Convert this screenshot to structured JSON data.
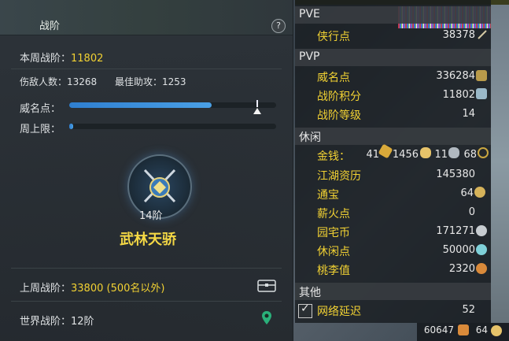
{
  "left": {
    "title": "战阶",
    "help": "?",
    "week_label": "本周战阶：",
    "week_value": "11802",
    "kills_label": "伤敌人数：13268",
    "assist_label": "最佳助攻：1253",
    "fame_label": "威名点：",
    "fame_progress": 0.69,
    "cap_label": "周上限：",
    "cap_progress": 0.02,
    "rank_level": "14阶",
    "rank_name": "武林天骄",
    "last_week_label": "上周战阶：",
    "last_week_value": "33800 (500名以外)",
    "world_label": "世界战阶：12阶"
  },
  "right": {
    "pve": {
      "header": "PVE",
      "rows": [
        {
          "label": "侠行点",
          "value": "38378"
        }
      ]
    },
    "pvp": {
      "header": "PVP",
      "rows": [
        {
          "label": "威名点",
          "value": "336284"
        },
        {
          "label": "战阶积分",
          "value": "11802"
        },
        {
          "label": "战阶等级",
          "value": "14"
        }
      ]
    },
    "leisure": {
      "header": "休闲",
      "money_label": "金钱：",
      "money_gold": "41",
      "money_silver": "1456",
      "money_copper": "11",
      "money_other": "68",
      "rows": [
        {
          "label": "江湖资历",
          "value": "145380"
        },
        {
          "label": "通宝",
          "value": "64"
        },
        {
          "label": "薪火点",
          "value": "0"
        },
        {
          "label": "园宅币",
          "value": "171271"
        },
        {
          "label": "休闲点",
          "value": "50000"
        },
        {
          "label": "桃李值",
          "value": "2320"
        }
      ]
    },
    "other": {
      "header": "其他",
      "latency_label": "网络延迟",
      "latency_value": "52"
    },
    "footer_a": "60647",
    "footer_b": "64"
  },
  "colors": {
    "accent": "#f2d233",
    "bar": "#3a8fe0"
  }
}
